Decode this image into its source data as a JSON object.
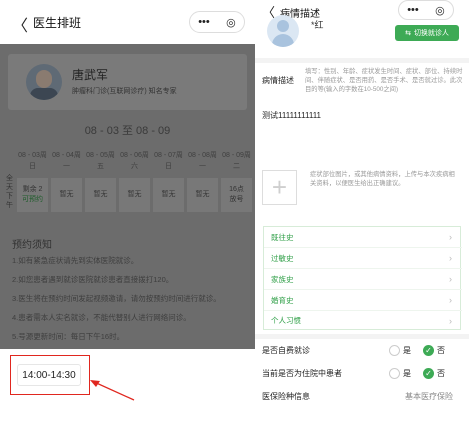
{
  "left": {
    "title": "医生排班",
    "doctor": {
      "name": "唐武军",
      "dept": "肿瘤科门诊(互联网诊疗) 知名专家"
    },
    "week_range": "08 - 03 至 08 - 09",
    "days": [
      {
        "date": "08 - 03周",
        "weekday": "日"
      },
      {
        "date": "08 - 04周",
        "weekday": "一"
      },
      {
        "date": "08 - 05周",
        "weekday": "五"
      },
      {
        "date": "08 - 06周",
        "weekday": "六"
      },
      {
        "date": "08 - 07周",
        "weekday": "日"
      },
      {
        "date": "08 - 08周",
        "weekday": "一"
      },
      {
        "date": "08 - 09周",
        "weekday": "二"
      }
    ],
    "period_label": "全天下午",
    "cells": [
      {
        "line1": "剩余 2",
        "line2": "可预约"
      },
      {
        "line1": "暂无",
        "line2": ""
      },
      {
        "line1": "暂无",
        "line2": ""
      },
      {
        "line1": "暂无",
        "line2": ""
      },
      {
        "line1": "暂无",
        "line2": ""
      },
      {
        "line1": "暂无",
        "line2": ""
      },
      {
        "line1": "16点",
        "line2": "放号"
      }
    ],
    "notice_title": "预约须知",
    "notices": [
      "1.如有紧急症状请先到实体医院就诊。",
      "2.如您患者遇到就诊医院就诊患者直接拨打120。",
      "3.医生将在预约时间发起视频邀请，请勿按预约时间进行就诊。",
      "4.患者需本人实名就诊，不能代替别人进行网络问诊。",
      "5.号源更新时间：每日下午16时。"
    ],
    "time_slot": "14:00-14:30",
    "capsule": {
      "more": "•••",
      "target": "◎"
    }
  },
  "right": {
    "title": "病情描述",
    "back": "〈",
    "capsule": {
      "more": "•••",
      "target": "◎"
    },
    "patient_name": "*红",
    "switch_label": "切换就诊人",
    "desc_label": "病情描述",
    "desc_hint": "填写：性别、年龄、症状发生时间、症状、部位、持续时间、伴随症状、是否用药、是否手术、是否就过诊。此次目的等(输入的字数在10-500之间)",
    "desc_value": "测试11111111111",
    "upload_hint": "症状部位图片，或其他病情资料，上传与本次疾病相关资料，以便医生给出正确建议。",
    "history": [
      "既往史",
      "过敏史",
      "家族史",
      "婚育史",
      "个人习惯"
    ],
    "q1": {
      "label": "是否自费就诊",
      "yes": "是",
      "no": "否"
    },
    "q2": {
      "label": "当前是否为住院中患者",
      "yes": "是",
      "no": "否"
    },
    "insurance": {
      "label": "医保险种信息",
      "value": "基本医疗保险"
    }
  },
  "colors": {
    "accent": "#3daa55",
    "highlight": "#e0271f",
    "overlay": "#6c6c6c"
  }
}
